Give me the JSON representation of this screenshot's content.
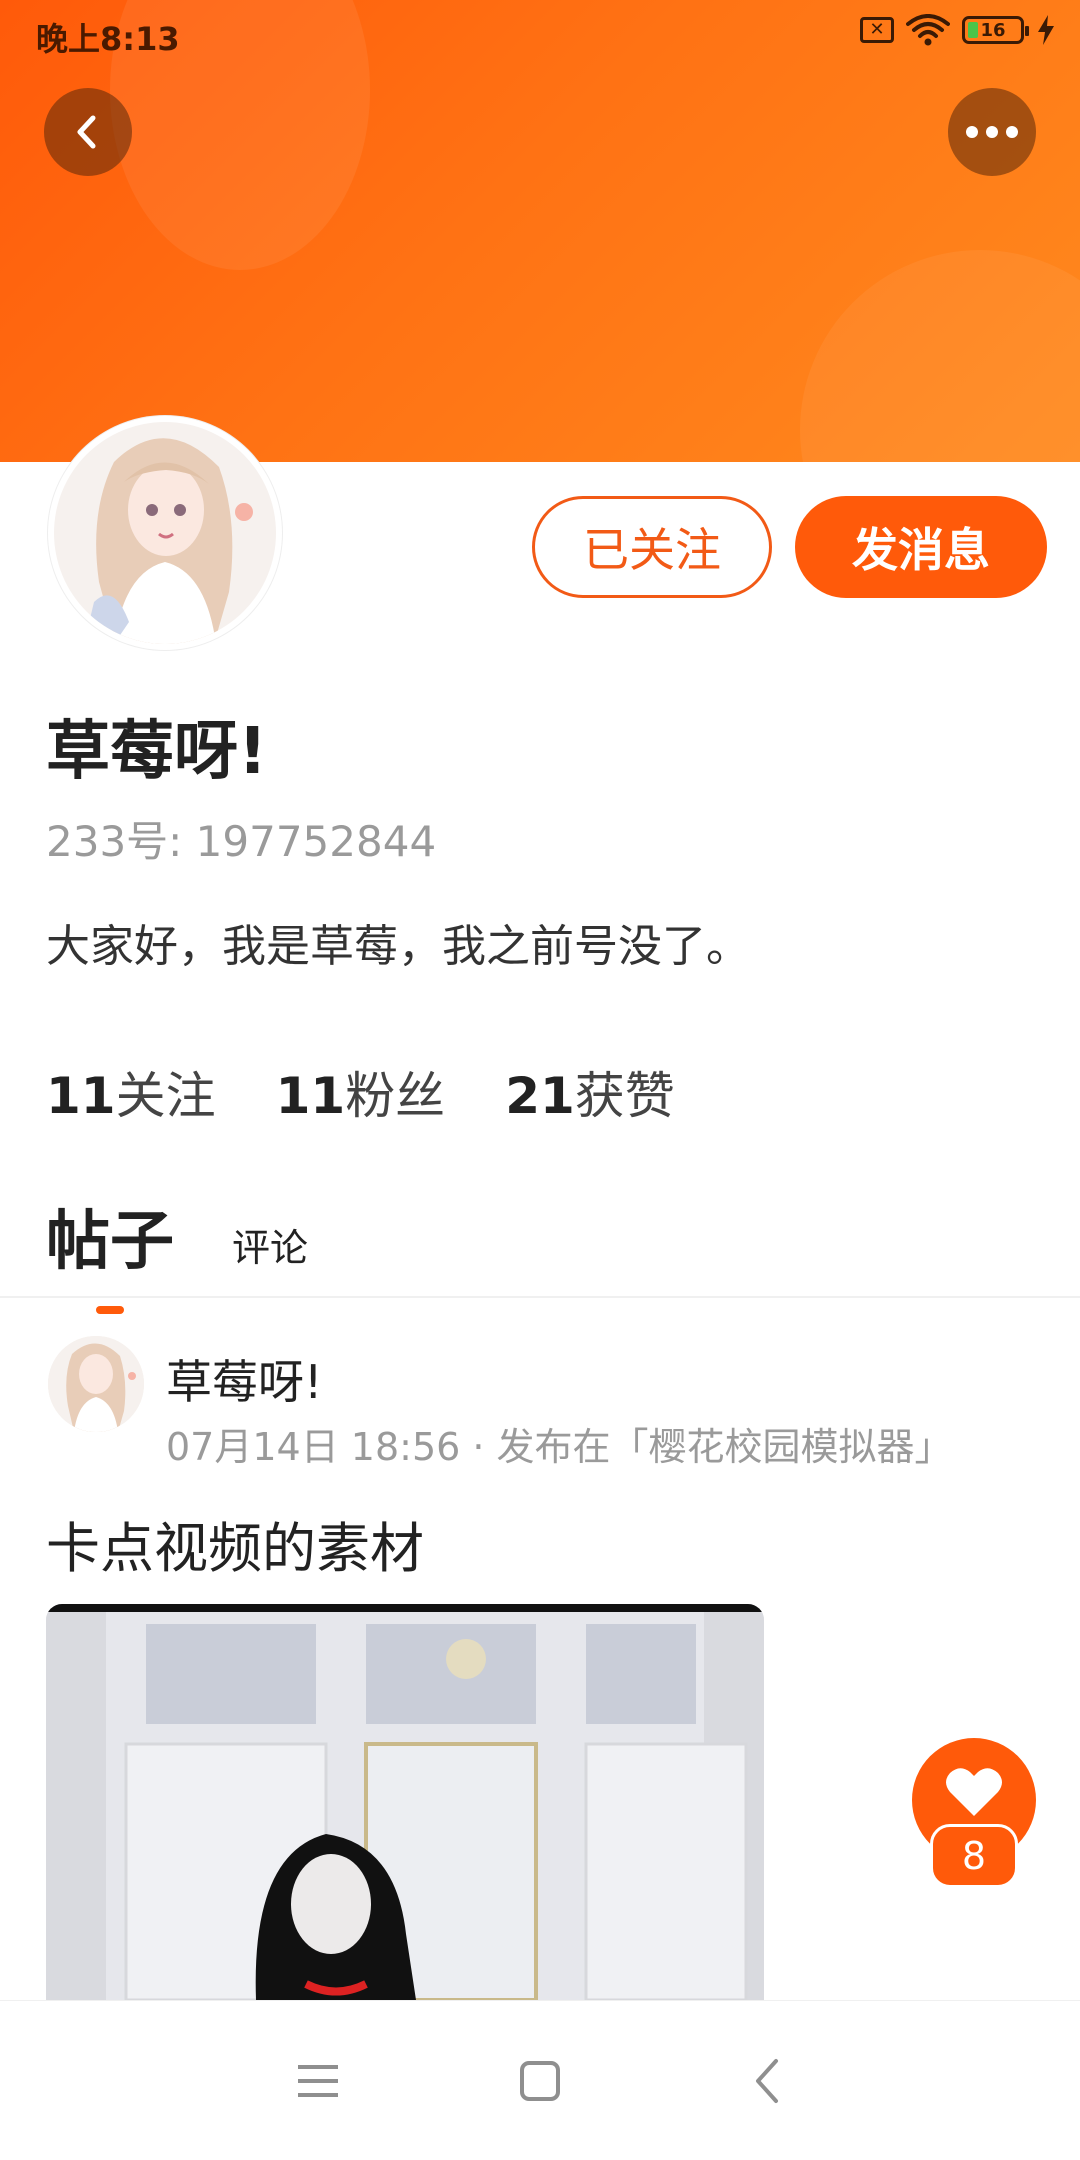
{
  "status_bar": {
    "time": "晚上8:13",
    "battery": "16",
    "sim_icon": "sim-x-icon",
    "wifi_icon": "wifi-icon",
    "charging_icon": "bolt-icon"
  },
  "header": {
    "back_icon": "chevron-left-icon",
    "more_icon": "more-dots-icon"
  },
  "profile": {
    "name": "草莓呀!",
    "uid": "233号: 197752844",
    "bio": "大家好，我是草莓，我之前号没了。",
    "follow_label": "已关注",
    "message_label": "发消息",
    "stats": [
      {
        "count": "11",
        "label": "关注"
      },
      {
        "count": "11",
        "label": "粉丝"
      },
      {
        "count": "21",
        "label": "获赞"
      }
    ]
  },
  "tabs": [
    {
      "label": "帖子",
      "active": true
    },
    {
      "label": "评论",
      "active": false
    }
  ],
  "post": {
    "author": "草莓呀!",
    "meta": "07月14日 18:56 · 发布在「樱花校园模拟器」",
    "title": "卡点视频的素材",
    "like_count": "8"
  },
  "colors": {
    "accent": "#ff5a0a",
    "banner_start": "#ff5a0a",
    "banner_end": "#ff8a1e"
  },
  "nav": {
    "menu_icon": "menu-icon",
    "home_icon": "square-home-icon",
    "back_icon": "nav-back-icon"
  }
}
